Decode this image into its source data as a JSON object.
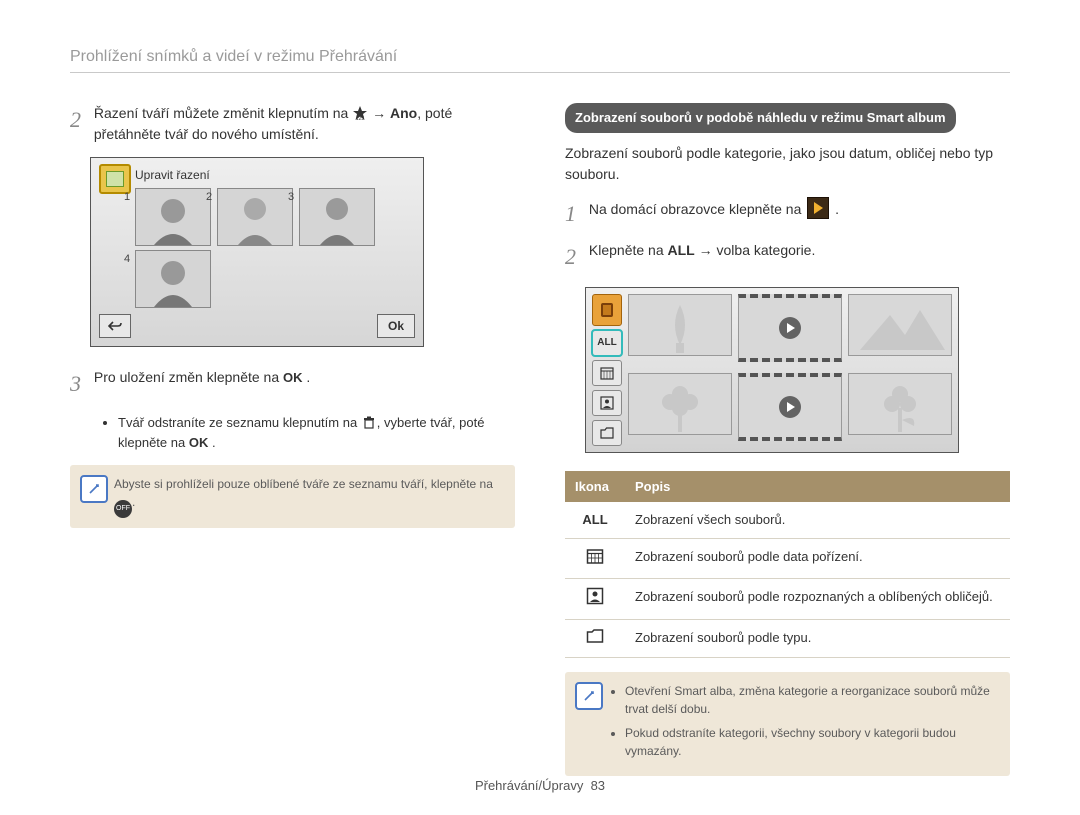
{
  "header": "Prohlížení snímků a videí v režimu Přehrávání",
  "left": {
    "step2": {
      "num": "2",
      "part1": "Řazení tváří můžete změnit klepnutím na ",
      "arrow": " → ",
      "bold_ano": "Ano",
      "part2": ", poté přetáhněte tvář do nového umístění."
    },
    "screen_title": "Upravit řazení",
    "thumb_nums": [
      "1",
      "2",
      "3",
      "4"
    ],
    "ok_label": "Ok",
    "step3": {
      "num": "3",
      "text": "Pro uložení změn klepněte na ",
      "ok": "OK"
    },
    "bullet": {
      "part1": "Tvář odstraníte ze seznamu klepnutím na ",
      "part2": ", vyberte tvář, poté klepněte na ",
      "ok": "OK"
    },
    "note": "Abyste si prohlíželi pouze oblíbené tváře ze seznamu tváří, klepněte na ",
    "off_icon_text": "OFF"
  },
  "right": {
    "heading": "Zobrazení souborů v podobě náhledu v režimu Smart album",
    "intro": "Zobrazení souborů podle kategorie, jako jsou datum, obličej nebo typ souboru.",
    "step1": {
      "num": "1",
      "text": "Na domácí obrazovce klepněte na "
    },
    "step2": {
      "num": "2",
      "part1": "Klepněte na ",
      "all": "ALL",
      "part2": " → volba kategorie."
    },
    "side_labels": {
      "all": "ALL"
    },
    "table": {
      "h1": "Ikona",
      "h2": "Popis",
      "rows": [
        {
          "icon_text": "ALL",
          "icon_type": "text",
          "desc": "Zobrazení všech souborů."
        },
        {
          "icon_type": "calendar",
          "desc": "Zobrazení souborů podle data pořízení."
        },
        {
          "icon_type": "face",
          "desc": "Zobrazení souborů podle rozpoznaných a oblíbených obličejů."
        },
        {
          "icon_type": "folder",
          "desc": "Zobrazení souborů podle typu."
        }
      ]
    },
    "note": {
      "b1": "Otevření Smart alba, změna kategorie a reorganizace souborů může trvat delší dobu.",
      "b2": "Pokud odstraníte kategorii, všechny soubory v kategorii budou vymazány."
    }
  },
  "footer": {
    "label": "Přehrávání/Úpravy",
    "page": "83"
  }
}
